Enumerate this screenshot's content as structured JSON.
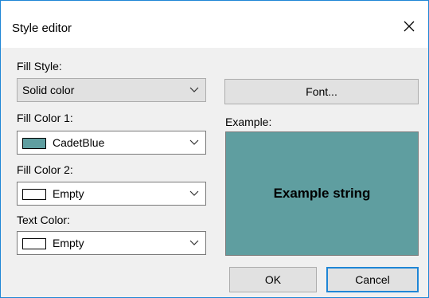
{
  "window": {
    "title": "Style editor"
  },
  "fill_style": {
    "label": "Fill Style:",
    "value": "Solid color"
  },
  "fill_color_1": {
    "label": "Fill Color 1:",
    "value": "CadetBlue",
    "swatch": "#5f9ea0"
  },
  "fill_color_2": {
    "label": "Fill Color 2:",
    "value": "Empty",
    "swatch": "#ffffff"
  },
  "text_color": {
    "label": "Text Color:",
    "value": "Empty",
    "swatch": "#ffffff"
  },
  "font_button": {
    "label": "Font..."
  },
  "example": {
    "label": "Example:",
    "text": "Example string",
    "background": "#5f9ea0",
    "text_color": "#000000"
  },
  "buttons": {
    "ok": "OK",
    "cancel": "Cancel"
  },
  "icons": {
    "close": "close-icon",
    "dropdown": "chevron-down-icon"
  }
}
